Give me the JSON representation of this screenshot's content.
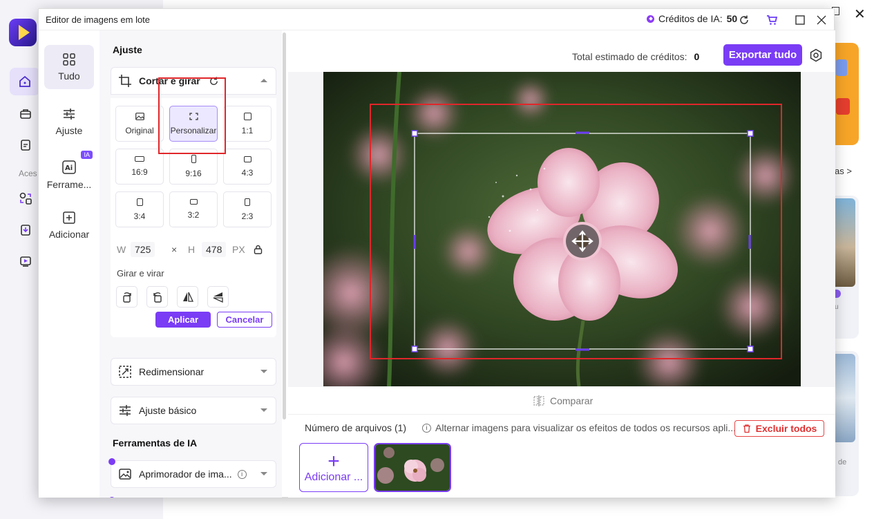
{
  "host_app": {
    "access_label": "Aces",
    "more_link": "as >",
    "card_text_1": "u",
    "card_text_2": "de"
  },
  "dialog": {
    "title": "Editor de imagens em lote",
    "credits_label": "Créditos de IA:",
    "credits_value": "50"
  },
  "nav": {
    "items": [
      {
        "label": "Tudo",
        "icon": "grid-icon"
      },
      {
        "label": "Ajuste",
        "icon": "sliders-icon"
      },
      {
        "label": "Ferrame...",
        "icon": "ai-tools-icon",
        "badge": "IA"
      },
      {
        "label": "Adicionar",
        "icon": "plus-square-icon"
      }
    ]
  },
  "panel": {
    "section_title": "Ajuste",
    "crop": {
      "title": "Cortar e girar",
      "ratios": [
        "Original",
        "Personalizar",
        "1:1",
        "16:9",
        "9:16",
        "4:3",
        "3:4",
        "3:2",
        "2:3"
      ],
      "selected_ratio": "Personalizar",
      "w_label": "W",
      "w_value": "725",
      "x_sep": "×",
      "h_label": "H",
      "h_value": "478",
      "unit": "PX",
      "rotate_label": "Girar e virar",
      "apply": "Aplicar",
      "cancel": "Cancelar"
    },
    "resize": "Redimensionar",
    "basic": "Ajuste básico",
    "ai_section_title": "Ferramentas de IA",
    "enhancer": "Aprimorador de ima..."
  },
  "main": {
    "total_label": "Total estimado de créditos:",
    "total_value": "0",
    "export": "Exportar tudo",
    "compare": "Comparar",
    "files_count": "Número de arquivos (1)",
    "hint": "Alternar imagens para visualizar os efeitos de todos os recursos apli...",
    "delete_all": "Excluir todos",
    "add_card": "Adicionar ..."
  },
  "colors": {
    "accent": "#7a3cf5",
    "danger": "#e03030",
    "annotation": "#e0262a"
  }
}
